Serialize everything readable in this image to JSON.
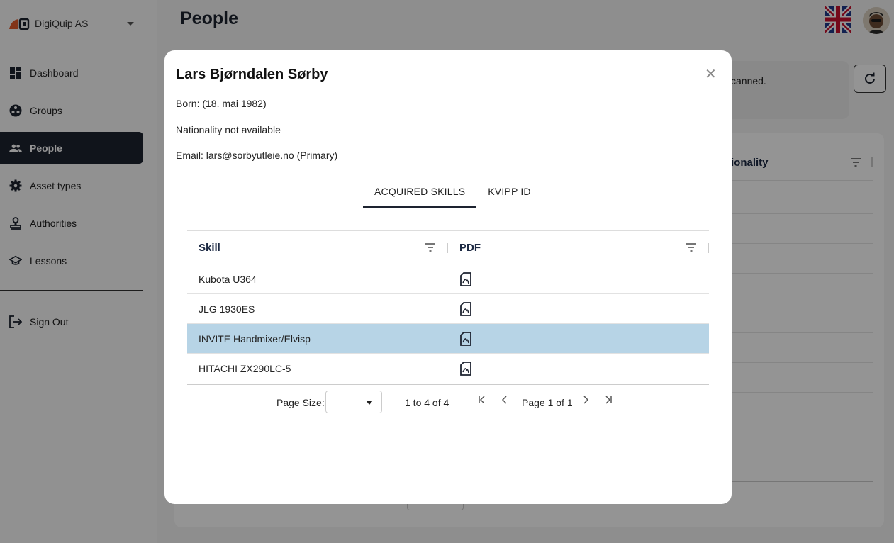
{
  "org": {
    "name": "DigiQuip AS"
  },
  "nav": {
    "items": [
      {
        "label": "Dashboard",
        "icon": "dashboard-icon"
      },
      {
        "label": "Groups",
        "icon": "groups-icon"
      },
      {
        "label": "People",
        "icon": "people-icon",
        "active": true
      },
      {
        "label": "Asset types",
        "icon": "gear-icon"
      },
      {
        "label": "Authorities",
        "icon": "stamp-icon"
      },
      {
        "label": "Lessons",
        "icon": "graduation-cap-icon"
      }
    ],
    "signout": "Sign Out"
  },
  "page": {
    "title": "People",
    "info_fragment": "canned.",
    "bg_column": "ionality"
  },
  "modal": {
    "name": "Lars Bjørndalen Sørby",
    "born": "Born: (18. mai 1982)",
    "nationality": "Nationality not available",
    "email": "Email: lars@sorbyutleie.no (Primary)",
    "tabs": [
      "ACQUIRED SKILLS",
      "KVIPP ID"
    ],
    "active_tab": 0,
    "grid": {
      "columns": [
        "Skill",
        "PDF"
      ],
      "rows": [
        {
          "skill": "Kubota U364"
        },
        {
          "skill": "JLG 1930ES"
        },
        {
          "skill": "INVITE Handmixer/Elvisp",
          "selected": true
        },
        {
          "skill": "HITACHI ZX290LC-5"
        }
      ],
      "page_size_label": "Page Size:",
      "page_size_value": "",
      "range": "1 to 4 of 4",
      "page_text": "Page 1 of 1"
    }
  },
  "colors": {
    "accent": "#1d2330",
    "selected_row": "#b7d4e6",
    "column_header": "#1d2a44"
  }
}
